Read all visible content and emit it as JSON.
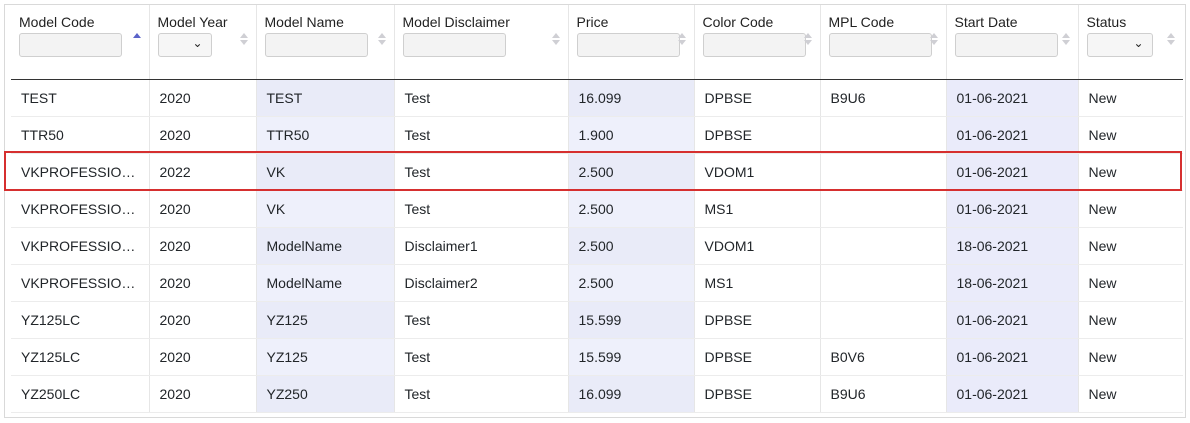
{
  "table": {
    "columns": [
      {
        "key": "code",
        "label": "Model Code",
        "filter": "text",
        "sort": "asc"
      },
      {
        "key": "year",
        "label": "Model Year",
        "filter": "select",
        "sort": "none"
      },
      {
        "key": "name",
        "label": "Model Name",
        "filter": "text",
        "sort": "none"
      },
      {
        "key": "disclaimer",
        "label": "Model Disclaimer",
        "filter": "text",
        "sort": "none"
      },
      {
        "key": "price",
        "label": "Price",
        "filter": "text",
        "sort": "none"
      },
      {
        "key": "color",
        "label": "Color Code",
        "filter": "text",
        "sort": "none"
      },
      {
        "key": "mpl",
        "label": "MPL Code",
        "filter": "text",
        "sort": "none"
      },
      {
        "key": "start",
        "label": "Start Date",
        "filter": "text",
        "sort": "none"
      },
      {
        "key": "status",
        "label": "Status",
        "filter": "select",
        "sort": "none"
      }
    ],
    "rows": [
      {
        "code": "TEST",
        "year": "2020",
        "name": "TEST",
        "disclaimer": "Test",
        "price": "16.099",
        "color": "DPBSE",
        "mpl": "B9U6",
        "start": "01-06-2021",
        "status": "New"
      },
      {
        "code": "TTR50",
        "year": "2020",
        "name": "TTR50",
        "disclaimer": "Test",
        "price": "1.900",
        "color": "DPBSE",
        "mpl": "",
        "start": "01-06-2021",
        "status": "New"
      },
      {
        "code": "VKPROFESSION...",
        "year": "2022",
        "name": "VK",
        "disclaimer": "Test",
        "price": "2.500",
        "color": "VDOM1",
        "mpl": "",
        "start": "01-06-2021",
        "status": "New",
        "highlighted": true
      },
      {
        "code": "VKPROFESSION...",
        "year": "2020",
        "name": "VK",
        "disclaimer": "Test",
        "price": "2.500",
        "color": "MS1",
        "mpl": "",
        "start": "01-06-2021",
        "status": "New"
      },
      {
        "code": "VKPROFESSION...",
        "year": "2020",
        "name": "ModelName",
        "disclaimer": "Disclaimer1",
        "price": "2.500",
        "color": "VDOM1",
        "mpl": "",
        "start": "18-06-2021",
        "status": "New"
      },
      {
        "code": "VKPROFESSION...",
        "year": "2020",
        "name": "ModelName",
        "disclaimer": "Disclaimer2",
        "price": "2.500",
        "color": "MS1",
        "mpl": "",
        "start": "18-06-2021",
        "status": "New"
      },
      {
        "code": "YZ125LC",
        "year": "2020",
        "name": "YZ125",
        "disclaimer": "Test",
        "price": "15.599",
        "color": "DPBSE",
        "mpl": "",
        "start": "01-06-2021",
        "status": "New"
      },
      {
        "code": "YZ125LC",
        "year": "2020",
        "name": "YZ125",
        "disclaimer": "Test",
        "price": "15.599",
        "color": "DPBSE",
        "mpl": "B0V6",
        "start": "01-06-2021",
        "status": "New"
      },
      {
        "code": "YZ250LC",
        "year": "2020",
        "name": "YZ250",
        "disclaimer": "Test",
        "price": "16.099",
        "color": "DPBSE",
        "mpl": "B9U6",
        "start": "01-06-2021",
        "status": "New"
      }
    ]
  },
  "colors": {
    "accent_sort": "#5b63c9",
    "highlight_border": "#d62f2f",
    "column_shade": "#eef0fb"
  },
  "icons": {
    "dropdown": "chevron-down-icon",
    "sort": "sort-icon"
  }
}
